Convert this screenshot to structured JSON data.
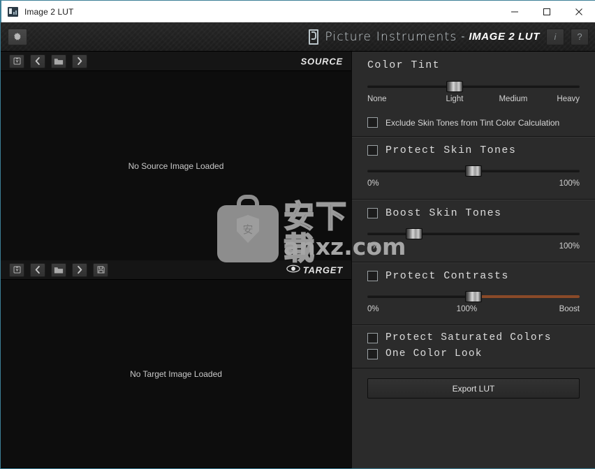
{
  "window": {
    "title": "Image 2 LUT",
    "app_icon": "app-logo-icon",
    "minimize": "minimize-icon",
    "maximize": "maximize-icon",
    "close": "close-icon"
  },
  "header": {
    "settings_icon": "gear-icon",
    "brand_logo": "picture-instruments-logo-icon",
    "brand": "Picture Instruments",
    "separator": "-",
    "product": "IMAGE 2 LUT",
    "info_label": "i",
    "help_label": "?"
  },
  "source_panel": {
    "label": "SOURCE",
    "placeholder": "No Source Image Loaded",
    "toolbar": [
      {
        "name": "paste-from-clipboard-button",
        "icon": "clipboard-icon"
      },
      {
        "name": "previous-image-button",
        "icon": "chevron-left-icon"
      },
      {
        "name": "open-folder-button",
        "icon": "folder-icon"
      },
      {
        "name": "next-image-button",
        "icon": "chevron-right-icon"
      }
    ]
  },
  "target_panel": {
    "label": "TARGET",
    "placeholder": "No Target Image Loaded",
    "preview_icon": "eye-icon",
    "toolbar": [
      {
        "name": "paste-from-clipboard-button",
        "icon": "clipboard-icon"
      },
      {
        "name": "previous-image-button",
        "icon": "chevron-left-icon"
      },
      {
        "name": "open-folder-button",
        "icon": "folder-icon"
      },
      {
        "name": "next-image-button",
        "icon": "chevron-right-icon"
      },
      {
        "name": "save-image-button",
        "icon": "floppy-disk-icon"
      }
    ]
  },
  "settings": {
    "color_tint": {
      "title": "Color Tint",
      "slider_percent": 41,
      "scale": [
        "None",
        "Light",
        "Medium",
        "Heavy"
      ],
      "exclude_skin_tones_label": "Exclude Skin Tones from Tint Color Calculation",
      "exclude_skin_tones_checked": false
    },
    "protect_skin_tones": {
      "title": "Protect Skin Tones",
      "checked": false,
      "slider_percent": 50,
      "min_label": "0%",
      "max_label": "100%"
    },
    "boost_skin_tones": {
      "title": "Boost Skin Tones",
      "checked": false,
      "slider_percent": 22,
      "min_label": "0%",
      "max_label": "100%"
    },
    "protect_contrasts": {
      "title": "Protect Contrasts",
      "checked": false,
      "slider_percent": 50,
      "min_label": "0%",
      "mid_label": "100%",
      "max_label": "Boost",
      "hot_color": "#8a4a28"
    },
    "protect_saturated_colors": {
      "title": "Protect Saturated Colors",
      "checked": false
    },
    "one_color_look": {
      "title": "One Color Look",
      "checked": false
    },
    "export": {
      "label": "Export LUT"
    }
  },
  "watermark": {
    "shield_char": "安",
    "cn_text": "安下载",
    "url_text": "anxz.com"
  }
}
